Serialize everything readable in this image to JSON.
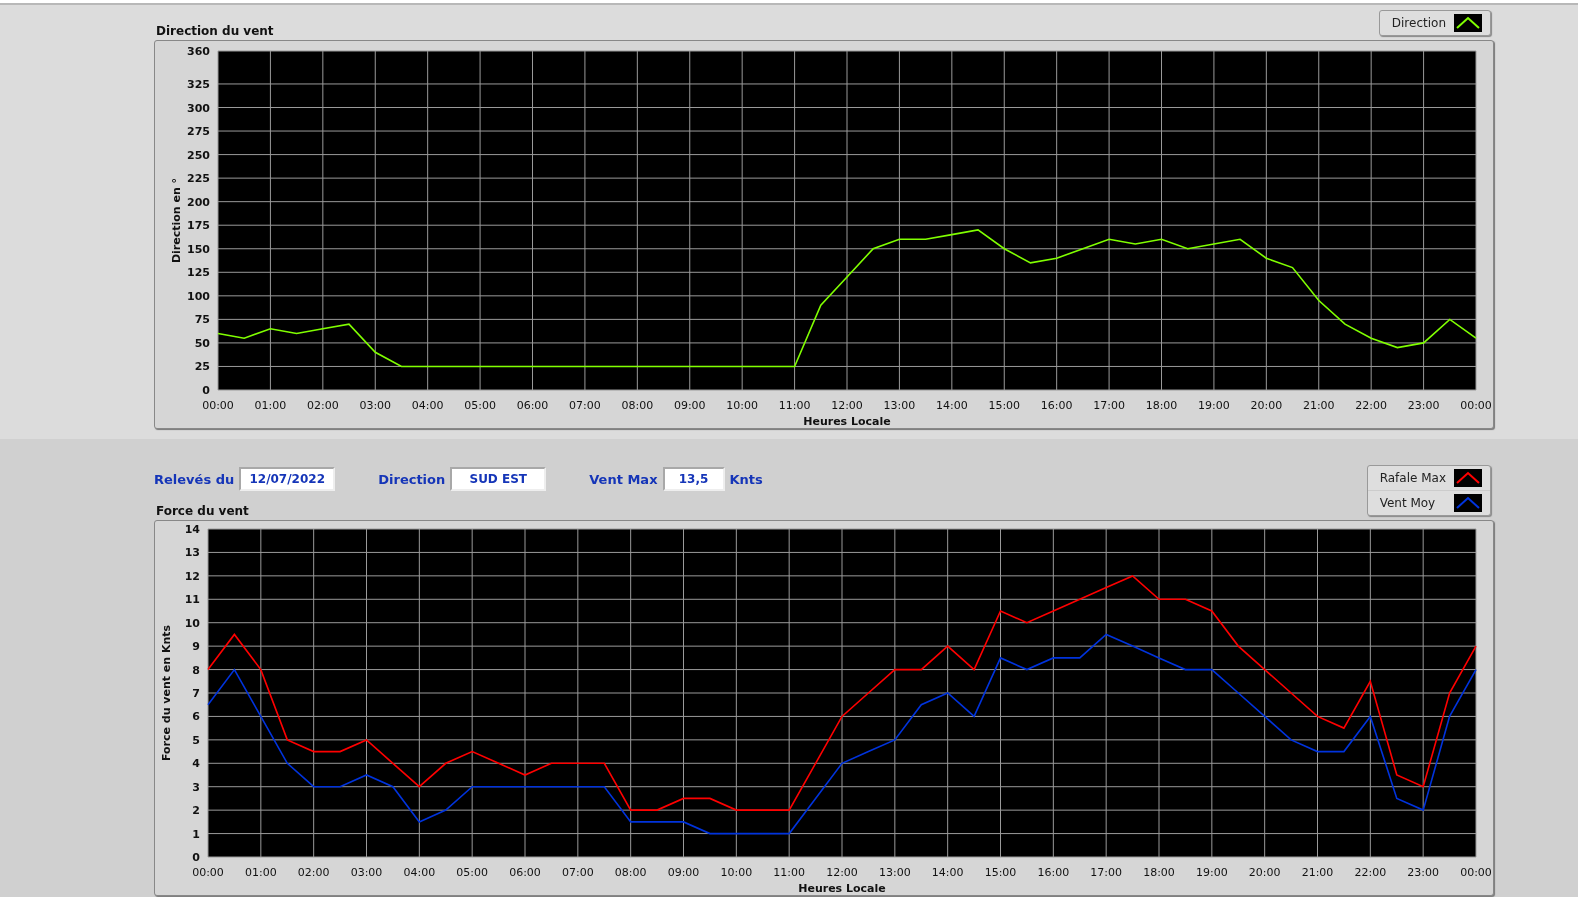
{
  "direction_chart": {
    "title": "Direction du vent",
    "chart_data": {
      "type": "line",
      "grid": true,
      "xlabel": "Heures Locale",
      "ylabel": "Direction en °",
      "xlim": [
        0,
        24
      ],
      "ylim": [
        0,
        360
      ],
      "x": [
        0,
        0.5,
        1,
        1.5,
        2,
        2.5,
        3,
        3.5,
        4,
        4.5,
        5,
        5.5,
        6,
        6.5,
        7,
        7.5,
        8,
        8.5,
        9,
        9.5,
        10,
        10.5,
        11,
        11.5,
        12,
        12.5,
        13,
        13.5,
        14,
        14.5,
        15,
        15.5,
        16,
        16.5,
        17,
        17.5,
        18,
        18.5,
        19,
        19.5,
        20,
        20.5,
        21,
        21.5,
        22,
        22.5,
        23,
        23.5,
        24
      ],
      "series": [
        {
          "name": "Direction",
          "color": "#80ff00",
          "values": [
            60,
            55,
            65,
            60,
            65,
            70,
            40,
            25,
            25,
            25,
            25,
            25,
            25,
            25,
            25,
            25,
            25,
            25,
            25,
            25,
            25,
            25,
            25,
            90,
            120,
            150,
            160,
            160,
            165,
            170,
            150,
            135,
            140,
            150,
            160,
            155,
            160,
            150,
            155,
            160,
            140,
            130,
            95,
            70,
            55,
            45,
            50,
            75,
            55
          ]
        }
      ],
      "xticks": [
        {
          "value": 0,
          "label": "00:00"
        },
        {
          "value": 1,
          "label": "01:00"
        },
        {
          "value": 2,
          "label": "02:00"
        },
        {
          "value": 3,
          "label": "03:00"
        },
        {
          "value": 4,
          "label": "04:00"
        },
        {
          "value": 5,
          "label": "05:00"
        },
        {
          "value": 6,
          "label": "06:00"
        },
        {
          "value": 7,
          "label": "07:00"
        },
        {
          "value": 8,
          "label": "08:00"
        },
        {
          "value": 9,
          "label": "09:00"
        },
        {
          "value": 10,
          "label": "10:00"
        },
        {
          "value": 11,
          "label": "11:00"
        },
        {
          "value": 12,
          "label": "12:00"
        },
        {
          "value": 13,
          "label": "13:00"
        },
        {
          "value": 14,
          "label": "14:00"
        },
        {
          "value": 15,
          "label": "15:00"
        },
        {
          "value": 16,
          "label": "16:00"
        },
        {
          "value": 17,
          "label": "17:00"
        },
        {
          "value": 18,
          "label": "18:00"
        },
        {
          "value": 19,
          "label": "19:00"
        },
        {
          "value": 20,
          "label": "20:00"
        },
        {
          "value": 21,
          "label": "21:00"
        },
        {
          "value": 22,
          "label": "22:00"
        },
        {
          "value": 23,
          "label": "23:00"
        },
        {
          "value": 24,
          "label": "00:00"
        }
      ],
      "yticks": [
        0,
        25,
        50,
        75,
        100,
        125,
        150,
        175,
        200,
        225,
        250,
        275,
        300,
        325,
        360
      ]
    }
  },
  "readings": {
    "date_label": "Relevés du",
    "date": "12/07/2022",
    "direction_label": "Direction",
    "direction": "SUD EST",
    "max_label": "Vent Max",
    "max": "13,5",
    "unit": "Knts"
  },
  "force_chart": {
    "title": "Force du vent",
    "chart_data": {
      "type": "line",
      "grid": true,
      "xlabel": "Heures Locale",
      "ylabel": "Force du vent en Knts",
      "xlim": [
        0,
        24
      ],
      "ylim": [
        0,
        14
      ],
      "x": [
        0,
        0.5,
        1,
        1.5,
        2,
        2.5,
        3,
        3.5,
        4,
        4.5,
        5,
        5.5,
        6,
        6.5,
        7,
        7.5,
        8,
        8.5,
        9,
        9.5,
        10,
        10.5,
        11,
        11.5,
        12,
        12.5,
        13,
        13.5,
        14,
        14.5,
        15,
        15.5,
        16,
        16.5,
        17,
        17.5,
        18,
        18.5,
        19,
        19.5,
        20,
        20.5,
        21,
        21.5,
        22,
        22.5,
        23,
        23.5,
        24
      ],
      "series": [
        {
          "name": "Rafale Max",
          "color": "#ff0000",
          "values": [
            8,
            9.5,
            8,
            5,
            4.5,
            4.5,
            5,
            4,
            3,
            4,
            4.5,
            4,
            3.5,
            4,
            4,
            4,
            2,
            2,
            2.5,
            2.5,
            2,
            2,
            2,
            4,
            6,
            7,
            8,
            8,
            9,
            8,
            10.5,
            10,
            10.5,
            11,
            11.5,
            12,
            11,
            11,
            10.5,
            9,
            8,
            7,
            6,
            5.5,
            7.5,
            3.5,
            3,
            7,
            9
          ]
        },
        {
          "name": "Vent Moy",
          "color": "#0033dd",
          "values": [
            6.5,
            8,
            6,
            4,
            3,
            3,
            3.5,
            3,
            1.5,
            2,
            3,
            3,
            3,
            3,
            3,
            3,
            1.5,
            1.5,
            1.5,
            1,
            1,
            1,
            1,
            2.5,
            4,
            4.5,
            5,
            6.5,
            7,
            6,
            8.5,
            8,
            8.5,
            8.5,
            9.5,
            9,
            8.5,
            8,
            8,
            7,
            6,
            5,
            4.5,
            4.5,
            6,
            2.5,
            2,
            6,
            8
          ]
        }
      ],
      "xticks": [
        {
          "value": 0,
          "label": "00:00"
        },
        {
          "value": 1,
          "label": "01:00"
        },
        {
          "value": 2,
          "label": "02:00"
        },
        {
          "value": 3,
          "label": "03:00"
        },
        {
          "value": 4,
          "label": "04:00"
        },
        {
          "value": 5,
          "label": "05:00"
        },
        {
          "value": 6,
          "label": "06:00"
        },
        {
          "value": 7,
          "label": "07:00"
        },
        {
          "value": 8,
          "label": "08:00"
        },
        {
          "value": 9,
          "label": "09:00"
        },
        {
          "value": 10,
          "label": "10:00"
        },
        {
          "value": 11,
          "label": "11:00"
        },
        {
          "value": 12,
          "label": "12:00"
        },
        {
          "value": 13,
          "label": "13:00"
        },
        {
          "value": 14,
          "label": "14:00"
        },
        {
          "value": 15,
          "label": "15:00"
        },
        {
          "value": 16,
          "label": "16:00"
        },
        {
          "value": 17,
          "label": "17:00"
        },
        {
          "value": 18,
          "label": "18:00"
        },
        {
          "value": 19,
          "label": "19:00"
        },
        {
          "value": 20,
          "label": "20:00"
        },
        {
          "value": 21,
          "label": "21:00"
        },
        {
          "value": 22,
          "label": "22:00"
        },
        {
          "value": 23,
          "label": "23:00"
        },
        {
          "value": 24,
          "label": "00:00"
        }
      ],
      "yticks": [
        0,
        1,
        2,
        3,
        4,
        5,
        6,
        7,
        8,
        9,
        10,
        11,
        12,
        13,
        14
      ]
    }
  }
}
